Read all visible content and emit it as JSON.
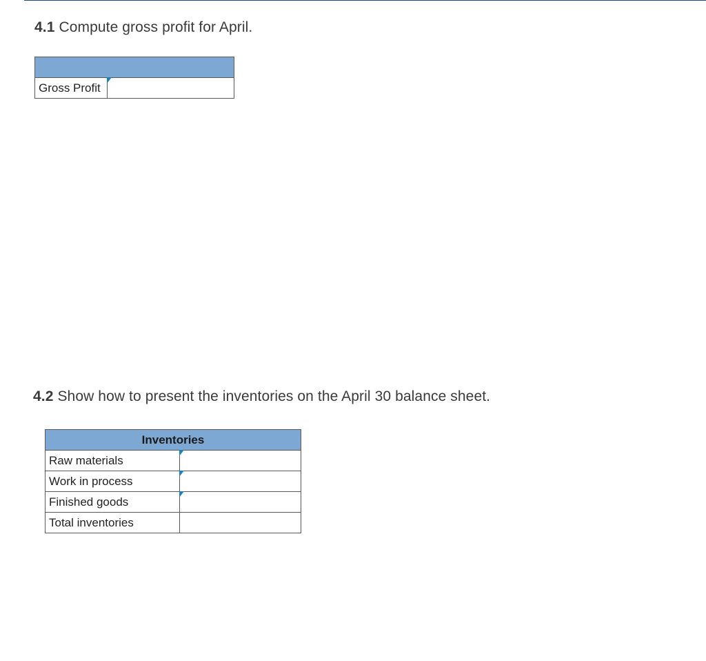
{
  "section1": {
    "number": "4.1",
    "prompt": "Compute gross profit for April.",
    "table": {
      "row_label": "Gross Profit"
    }
  },
  "section2": {
    "number": "4.2",
    "prompt": "Show how to present the inventories on the April 30 balance sheet.",
    "table": {
      "header": "Inventories",
      "rows": [
        "Raw materials",
        "Work in process",
        "Finished goods",
        "Total inventories"
      ]
    }
  }
}
